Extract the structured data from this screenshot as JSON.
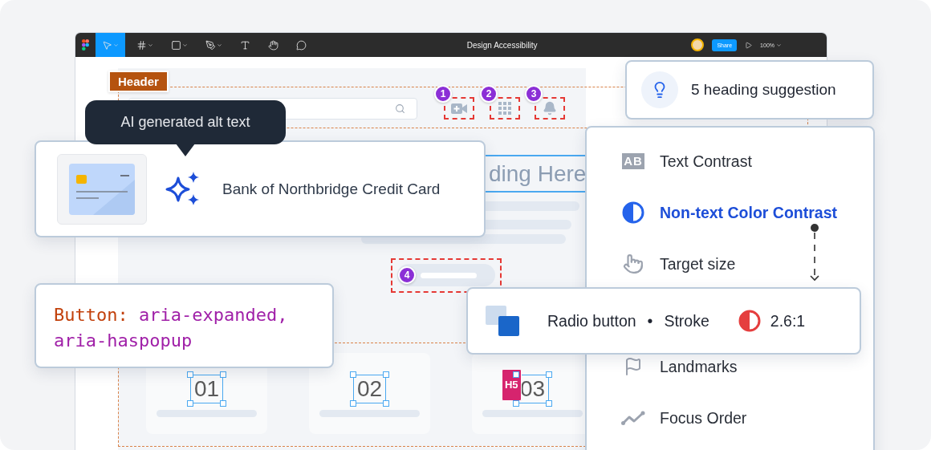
{
  "window": {
    "title": "Design Accessibility"
  },
  "toolbar": {
    "tools": [
      {
        "kind": "move",
        "selected": true,
        "menu": true
      },
      {
        "kind": "frame",
        "selected": false,
        "menu": true
      },
      {
        "kind": "shape",
        "selected": false,
        "menu": true
      },
      {
        "kind": "pen",
        "selected": false,
        "menu": true
      },
      {
        "kind": "text",
        "selected": false,
        "menu": false
      },
      {
        "kind": "hand",
        "selected": false,
        "menu": false
      },
      {
        "kind": "comment",
        "selected": false,
        "menu": false
      }
    ],
    "share": "Share",
    "zoom": "100%"
  },
  "canvas": {
    "header_label": "Header",
    "markers": [
      {
        "number": "1",
        "kind": "video"
      },
      {
        "number": "2",
        "kind": "grid"
      },
      {
        "number": "3",
        "kind": "bell"
      }
    ],
    "heading": "ding Here",
    "button_marker": "4",
    "cards": [
      {
        "number": "01",
        "selected": true
      },
      {
        "number": "02",
        "selected": true
      },
      {
        "number": "03",
        "selected": true,
        "tag": "H5"
      }
    ]
  },
  "alt_text": {
    "tooltip": "AI generated alt text",
    "text": "Bank of Northbridge Credit Card"
  },
  "code": {
    "keyword": "Button:",
    "lines": [
      "aria-expanded,",
      "aria-haspopup"
    ]
  },
  "suggestion": {
    "text": "5 heading suggestion"
  },
  "checks": [
    {
      "kind": "text",
      "label": "Text Contrast",
      "icon_text": "AB",
      "selected": false
    },
    {
      "kind": "contrast",
      "label": "Non-text Color Contrast",
      "selected": true
    },
    {
      "kind": "target",
      "label": "Target size",
      "selected": false
    },
    {
      "kind": "landmarks",
      "label": "Landmarks",
      "selected": false
    },
    {
      "kind": "focus",
      "label": "Focus Order",
      "selected": false
    }
  ],
  "issue": {
    "element": "Radio button",
    "separator": "•",
    "property": "Stroke",
    "ratio": "2.6:1"
  }
}
